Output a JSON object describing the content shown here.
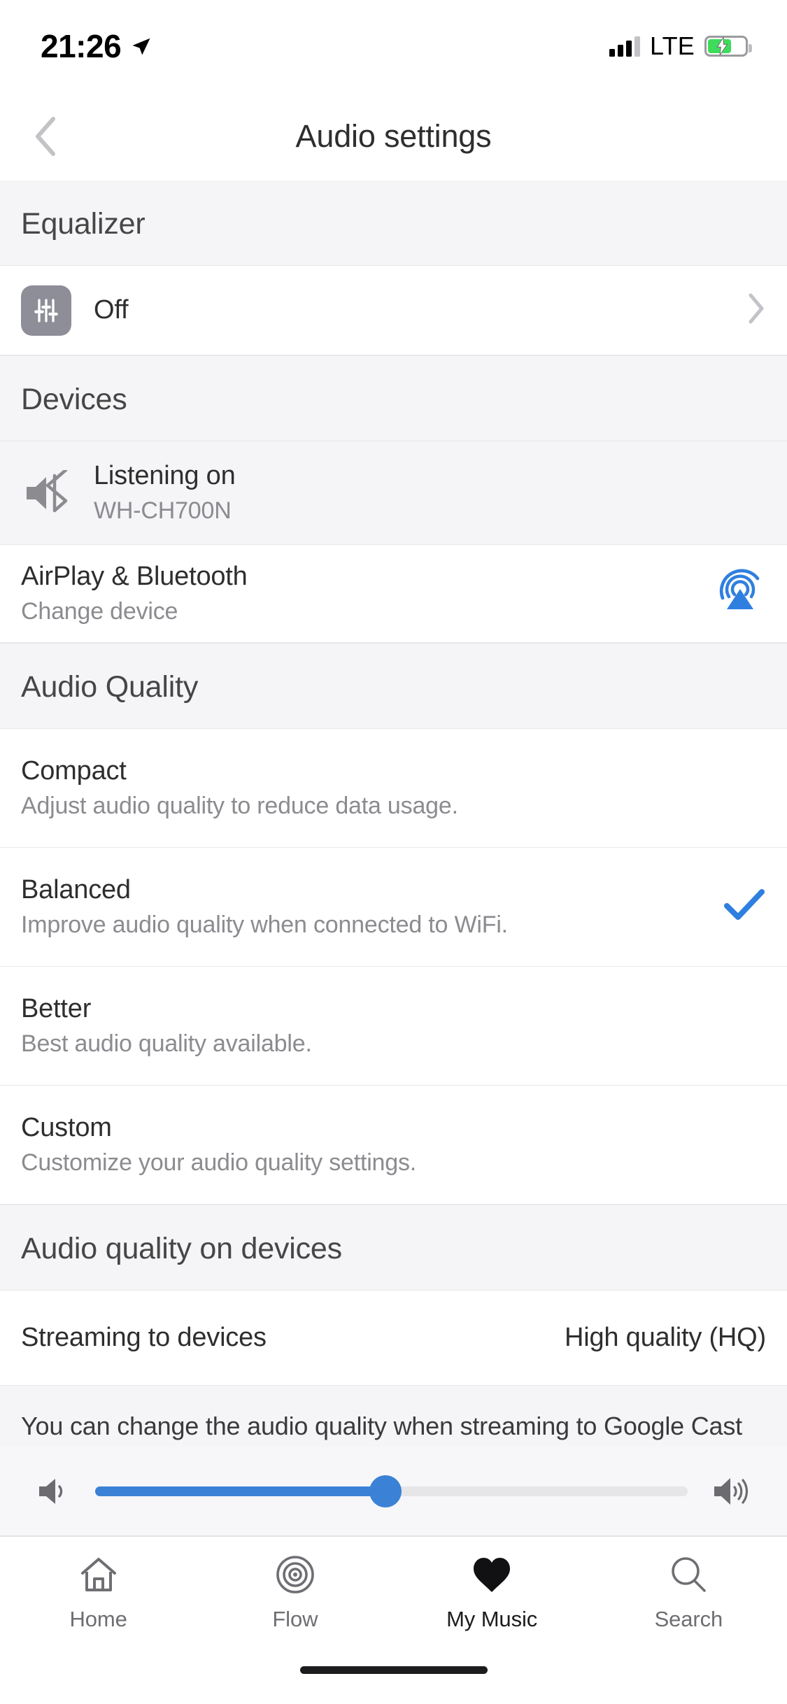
{
  "status_bar": {
    "time": "21:26",
    "carrier_type": "LTE",
    "location_icon": "location-arrow-icon",
    "signal_icon": "cellular-signal-icon",
    "battery_icon": "battery-charging-icon",
    "battery_level_percent": 64
  },
  "header": {
    "title": "Audio settings",
    "back_icon": "chevron-left-icon"
  },
  "sections": {
    "equalizer": {
      "header": "Equalizer",
      "row": {
        "icon": "equalizer-sliders-icon",
        "value": "Off",
        "chevron": "chevron-right-icon"
      }
    },
    "devices": {
      "header": "Devices",
      "listening": {
        "icon": "speaker-bluetooth-icon",
        "title": "Listening on",
        "subtitle": "WH-CH700N"
      },
      "airplay": {
        "title": "AirPlay & Bluetooth",
        "subtitle": "Change device",
        "icon": "airplay-cast-icon"
      }
    },
    "audio_quality": {
      "header": "Audio Quality",
      "options": [
        {
          "title": "Compact",
          "subtitle": "Adjust audio quality to reduce data usage.",
          "selected": false
        },
        {
          "title": "Balanced",
          "subtitle": "Improve audio quality when connected to WiFi.",
          "selected": true
        },
        {
          "title": "Better",
          "subtitle": "Best audio quality available.",
          "selected": false
        },
        {
          "title": "Custom",
          "subtitle": "Customize your audio quality settings.",
          "selected": false
        }
      ],
      "check_icon": "checkmark-icon"
    },
    "audio_quality_on_devices": {
      "header": "Audio quality on devices",
      "streaming_row": {
        "label": "Streaming to devices",
        "value": "High quality (HQ)"
      },
      "note": "You can change the audio quality when streaming to Google Cast devices"
    }
  },
  "volume": {
    "low_icon": "volume-low-icon",
    "high_icon": "volume-high-icon",
    "level_percent": 49
  },
  "tabbar": {
    "tabs": [
      {
        "label": "Home",
        "icon": "home-icon",
        "active": false
      },
      {
        "label": "Flow",
        "icon": "flow-target-icon",
        "active": false
      },
      {
        "label": "My Music",
        "icon": "heart-icon",
        "active": true
      },
      {
        "label": "Search",
        "icon": "search-icon",
        "active": false
      }
    ]
  },
  "colors": {
    "accent_blue": "#3b82d6",
    "check_blue": "#2f7fe0",
    "section_bg": "#f5f5f7",
    "battery_green": "#3ddc5b"
  }
}
